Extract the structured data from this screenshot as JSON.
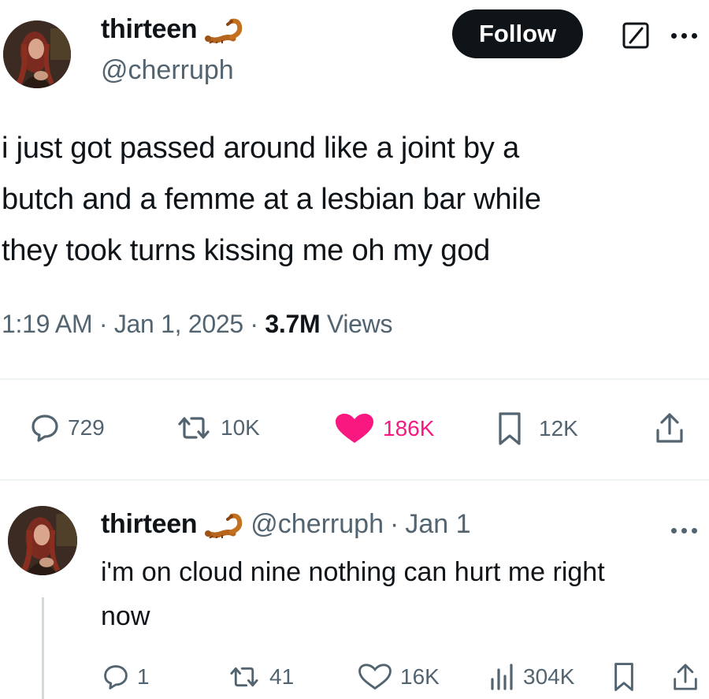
{
  "tweet": {
    "display_name": "thirteen",
    "handle": "@cherruph",
    "follow_label": "Follow",
    "text": "i just got passed around like a joint by a butch and a femme at a lesbian bar while they took turns kissing me oh my god",
    "lines": [
      "i just got passed around like a joint by a",
      "butch and a femme at a lesbian bar while",
      "they took turns kissing me oh my god"
    ],
    "time": "1:19 AM",
    "date": "Jan 1, 2025",
    "views_count": "3.7M",
    "views_label": "Views",
    "separator": "·",
    "stats": {
      "replies": "729",
      "reposts": "10K",
      "likes": "186K",
      "bookmarks": "12K"
    }
  },
  "reply": {
    "display_name": "thirteen",
    "handle": "@cherruph",
    "separator": "·",
    "date": "Jan 1",
    "line1": "i'm on cloud nine nothing can hurt me right",
    "line2": "now",
    "stats": {
      "replies": "1",
      "reposts": "41",
      "likes": "16K",
      "views": "304K"
    }
  },
  "colors": {
    "like_active": "#f91880",
    "secondary_text": "#536471",
    "primary_text": "#0f1419",
    "follow_bg": "#0f1419"
  },
  "icons": [
    "scorpion-emoji-icon",
    "edit-icon",
    "more-icon",
    "reply-icon",
    "repost-icon",
    "heart-icon",
    "bookmark-icon",
    "share-icon",
    "views-icon"
  ]
}
